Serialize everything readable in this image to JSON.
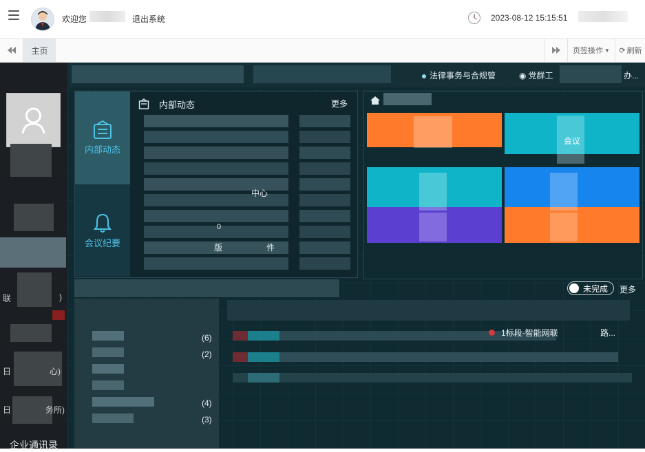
{
  "header": {
    "welcome": "欢迎您",
    "logout": "退出系统",
    "datetime": "2023-08-12 15:15:51"
  },
  "tabs": {
    "home": "主页",
    "ops": "页签操作",
    "refresh": "刷新"
  },
  "sidebar": {
    "contacts": "企业通讯录",
    "fragments": [
      "联",
      ")",
      "日",
      "心)",
      "日",
      "务所)"
    ]
  },
  "main": {
    "nav_item_1": "法律事务与合规管",
    "nav_item_2": "党群工",
    "nav_item_3": "办...",
    "internal_news_tab": "内部动态",
    "meeting_tab": "会议纪要",
    "internal_news_title": "内部动态",
    "more": "更多",
    "news_fragments": [
      "中心",
      "0",
      "版",
      "件"
    ],
    "meeting_tile": "会议",
    "todo_toggle": "未完成",
    "todo_more": "更多",
    "todo_counts": [
      "(6)",
      "(2)",
      "(4)",
      "(3)"
    ],
    "todo_item_fragment": "1标段-智能网联",
    "todo_item_suffix": "路..."
  },
  "colors": {
    "tile_orange": "#ff7b2b",
    "tile_cyan": "#0fb4c8",
    "tile_blue": "#1685ee",
    "tile_purple": "#5b3fd0",
    "main_bg": "#0f2a31"
  },
  "icons": {
    "menu": "menu-icon",
    "clock": "clock-icon",
    "news": "news-icon",
    "bell": "bell-icon",
    "home": "home-icon",
    "user": "user-icon"
  }
}
